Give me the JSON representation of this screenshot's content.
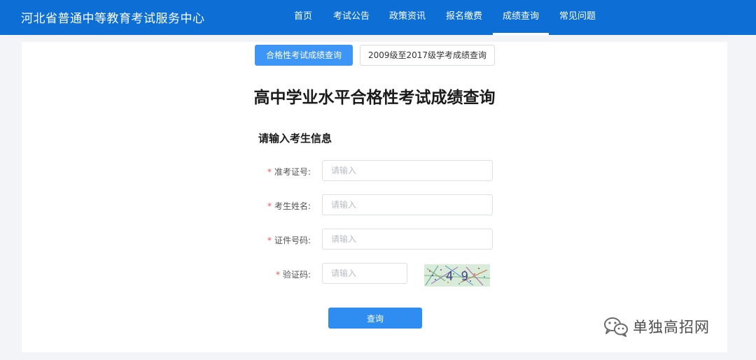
{
  "header": {
    "site_title": "河北省普通中等教育考试服务中心",
    "nav": [
      {
        "label": "首页"
      },
      {
        "label": "考试公告"
      },
      {
        "label": "政策资讯"
      },
      {
        "label": "报名缴费"
      },
      {
        "label": "成绩查询",
        "active": true
      },
      {
        "label": "常见问题"
      }
    ]
  },
  "tabs": [
    {
      "label": "合格性考试成绩查询",
      "active": true
    },
    {
      "label": "2009级至2017级学考成绩查询"
    }
  ],
  "main": {
    "title": "高中学业水平合格性考试成绩查询",
    "section_title": "请输入考生信息"
  },
  "form": {
    "required_mark": "*",
    "fields": [
      {
        "label": "准考证号:",
        "placeholder": "请输入",
        "value": ""
      },
      {
        "label": "考生姓名:",
        "placeholder": "请输入",
        "value": ""
      },
      {
        "label": "证件号码:",
        "placeholder": "请输入",
        "value": ""
      },
      {
        "label": "验证码:",
        "placeholder": "请输入",
        "value": ""
      }
    ],
    "captcha_text": "4 9",
    "submit_label": "查询"
  },
  "watermark": {
    "text": "单独高招网",
    "icon": "wechat-icon"
  },
  "colors": {
    "header_bg": "#0d6fd6",
    "primary": "#2f8cf0",
    "required": "#f05454",
    "page_bg": "#f2f4f7"
  }
}
